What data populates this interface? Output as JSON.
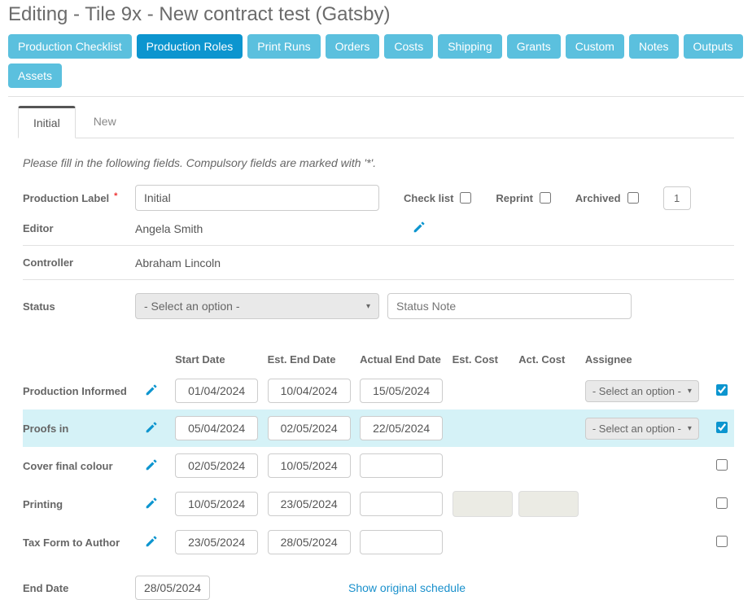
{
  "page_title": "Editing - Tile 9x - New contract test (Gatsby)",
  "nav": [
    {
      "label": "Production Checklist",
      "active": false
    },
    {
      "label": "Production Roles",
      "active": true
    },
    {
      "label": "Print Runs",
      "active": false
    },
    {
      "label": "Orders",
      "active": false
    },
    {
      "label": "Costs",
      "active": false
    },
    {
      "label": "Shipping",
      "active": false
    },
    {
      "label": "Grants",
      "active": false
    },
    {
      "label": "Custom",
      "active": false
    },
    {
      "label": "Notes",
      "active": false
    },
    {
      "label": "Outputs",
      "active": false
    },
    {
      "label": "Assets",
      "active": false
    }
  ],
  "inner_tabs": [
    {
      "label": "Initial",
      "active": true
    },
    {
      "label": "New",
      "active": false
    }
  ],
  "intro": "Please fill in the following fields. Compulsory fields are marked with '*'.",
  "form": {
    "prod_label_label": "Production Label",
    "prod_label_value": "Initial",
    "check_list_label": "Check list",
    "reprint_label": "Reprint",
    "archived_label": "Archived",
    "count_value": "1",
    "editor_label": "Editor",
    "editor_value": "Angela Smith",
    "controller_label": "Controller",
    "controller_value": "Abraham Lincoln",
    "status_label": "Status",
    "status_select_placeholder": "- Select an option -",
    "status_note_placeholder": "Status Note"
  },
  "schedule": {
    "headers": {
      "start": "Start Date",
      "est_end": "Est. End Date",
      "actual_end": "Actual End Date",
      "est_cost": "Est. Cost",
      "act_cost": "Act. Cost",
      "assignee": "Assignee"
    },
    "assignee_placeholder": "- Select an option -",
    "rows": [
      {
        "name": "Production Informed",
        "start": "01/04/2024",
        "est_end": "10/04/2024",
        "actual_end": "15/05/2024",
        "show_assignee": true,
        "checked": true,
        "highlight": false,
        "disabled_costs": false,
        "show_actual": true
      },
      {
        "name": "Proofs in",
        "start": "05/04/2024",
        "est_end": "02/05/2024",
        "actual_end": "22/05/2024",
        "show_assignee": true,
        "checked": true,
        "highlight": true,
        "disabled_costs": false,
        "show_actual": true
      },
      {
        "name": "Cover final colour",
        "start": "02/05/2024",
        "est_end": "10/05/2024",
        "actual_end": "",
        "show_assignee": false,
        "checked": false,
        "highlight": false,
        "disabled_costs": false,
        "show_actual": true
      },
      {
        "name": "Printing",
        "start": "10/05/2024",
        "est_end": "23/05/2024",
        "actual_end": "",
        "show_assignee": false,
        "checked": false,
        "highlight": false,
        "disabled_costs": true,
        "show_actual": true
      },
      {
        "name": "Tax Form to Author",
        "start": "23/05/2024",
        "est_end": "28/05/2024",
        "actual_end": "",
        "show_assignee": false,
        "checked": false,
        "highlight": false,
        "disabled_costs": false,
        "show_actual": true
      }
    ],
    "end_date_label": "End Date",
    "end_date_value": "28/05/2024",
    "show_orig": "Show original schedule"
  }
}
